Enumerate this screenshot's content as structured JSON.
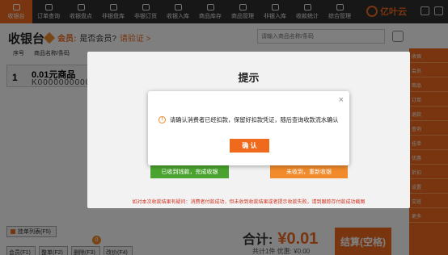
{
  "nav": {
    "items": [
      {
        "label": "收银台",
        "active": true
      },
      {
        "label": "订单查询",
        "active": false
      },
      {
        "label": "收银盘点",
        "active": false
      },
      {
        "label": "非银盘库",
        "active": false
      },
      {
        "label": "非银订货",
        "active": false
      },
      {
        "label": "收银入库",
        "active": false
      },
      {
        "label": "商品库存",
        "active": false
      },
      {
        "label": "商品管理",
        "active": false
      },
      {
        "label": "非银入库",
        "active": false
      },
      {
        "label": "收款统计",
        "active": false
      },
      {
        "label": "综合管理",
        "active": false
      }
    ],
    "brand": "亿叶云"
  },
  "header": {
    "title": "收银台",
    "member_label": "会员:",
    "member_question": "是否会员?",
    "member_link": "请验证 >",
    "search_placeholder": "请输入商品名称/条码"
  },
  "table": {
    "col_no": "序号",
    "col_name": "商品名称/条码",
    "rows": [
      {
        "no": "1",
        "name": "0.01元商品",
        "code": "K0000000000"
      }
    ]
  },
  "right_panel": {
    "items": [
      "收银",
      "会员",
      "商品",
      "订单",
      "退款",
      "查询",
      "挂单",
      "优惠",
      "折扣",
      "设置",
      "交班",
      "更多"
    ]
  },
  "bottom": {
    "hang_label": "挂单列表(F5)",
    "buttons": [
      "会员(F1)",
      "整单(F2)",
      "删除(F3)",
      "改价(F4)"
    ],
    "badge": "0",
    "total_label": "合计:",
    "total_amount": "¥0.01",
    "sub_text": "共计1件  优惠: ¥0.00",
    "settle_label": "结算(空格)"
  },
  "hint_dialog": {
    "title": "提示",
    "paid_button": "已收到钱款，完成收银",
    "unpaid_button": "未收到，重新收银",
    "note": "如对本次收款结果有疑问：消费者付款成功，但未收到收款结果或者提示收款失败，请到跟踪存付款成功截图"
  },
  "confirm_dialog": {
    "close_glyph": "×",
    "warn_glyph": "!",
    "message": "请确认消费者已经扣款，保留好扣款凭证，随后查询收款流水确认",
    "ok_label": "确 认"
  },
  "colors": {
    "accent": "#f06a1e",
    "nav_bg": "#2f2f2f",
    "green": "#4aa32e",
    "warn": "#f08a2a",
    "note_red": "#d4321e"
  }
}
